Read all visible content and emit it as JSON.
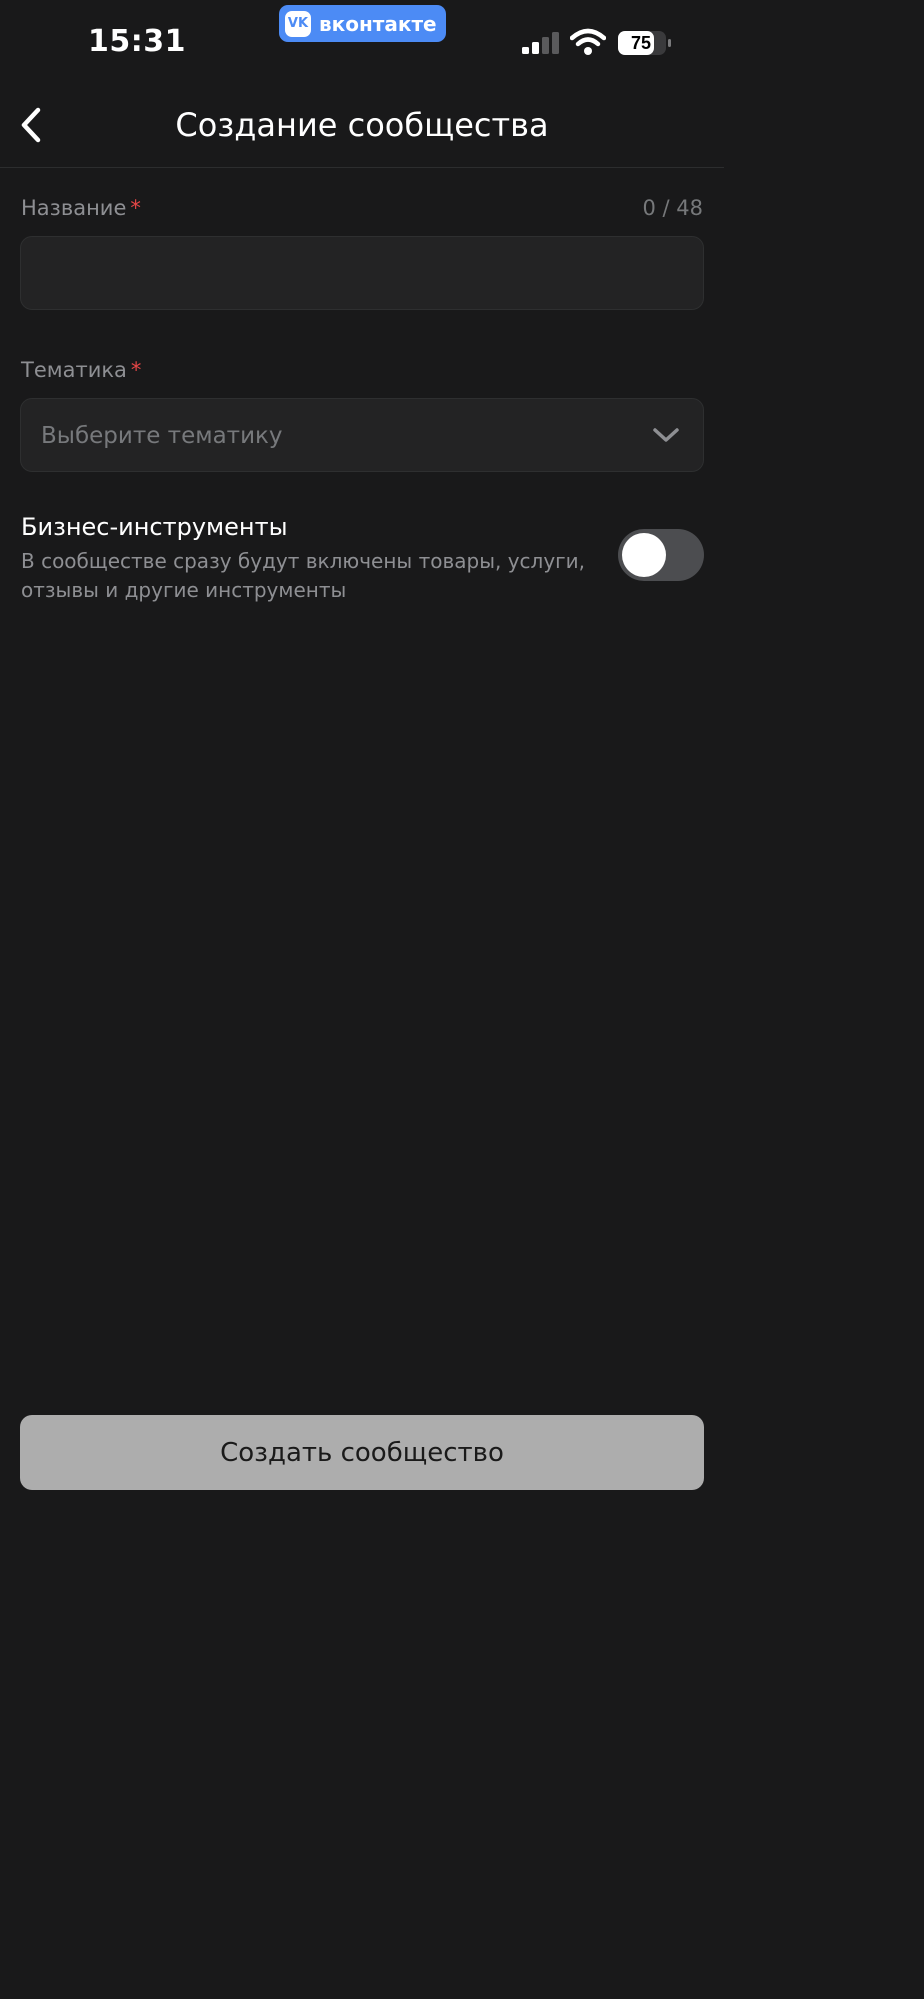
{
  "status_bar": {
    "time": "15:31",
    "app_badge": "вконтакте",
    "app_badge_logo": "VK",
    "battery": "75"
  },
  "nav": {
    "title": "Создание сообщества",
    "back_icon": "chevron-left-icon"
  },
  "form": {
    "name_field": {
      "label": "Название",
      "required_mark": "*",
      "counter": "0 / 48",
      "value": ""
    },
    "topic_field": {
      "label": "Тематика",
      "required_mark": "*",
      "placeholder": "Выберите тематику",
      "icon": "chevron-down-icon"
    },
    "business_tools": {
      "title": "Бизнес-инструменты",
      "description": "В сообществе сразу будут включены товары, услуги, отзывы и другие инструменты",
      "enabled": false
    }
  },
  "footer": {
    "create_button": "Создать сообщество"
  },
  "colors": {
    "background": "#19191a",
    "accent": "#4c8bf5",
    "required": "#e64646",
    "button_disabled": "#adadad"
  }
}
